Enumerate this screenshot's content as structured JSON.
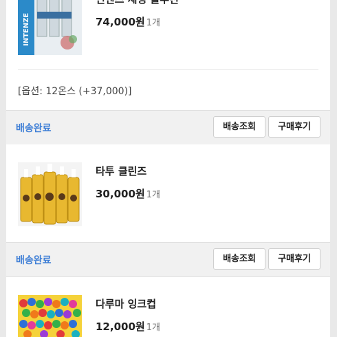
{
  "orders": [
    {
      "name": "인텐즈 세팅 솔루션",
      "amount": "74,000원",
      "qty": "1개",
      "option": "[옵션: 12온스 (+37,000)]",
      "status": "배송완료",
      "track_label": "배송조회",
      "review_label": "구매후기",
      "thumb_icon": "solution-bottles-image"
    },
    {
      "name": "타투 클린즈",
      "amount": "30,000원",
      "qty": "1개",
      "status": "배송완료",
      "track_label": "배송조회",
      "review_label": "구매후기",
      "thumb_icon": "cleanser-bottles-image"
    },
    {
      "name": "다루마 잉크컵",
      "amount": "12,000원",
      "qty": "1개",
      "thumb_icon": "ink-cups-image"
    }
  ],
  "colors": {
    "status_blue": "#3f7fd6",
    "panel_bg": "#ffffff",
    "status_bar_bg": "#f1f1f1"
  }
}
